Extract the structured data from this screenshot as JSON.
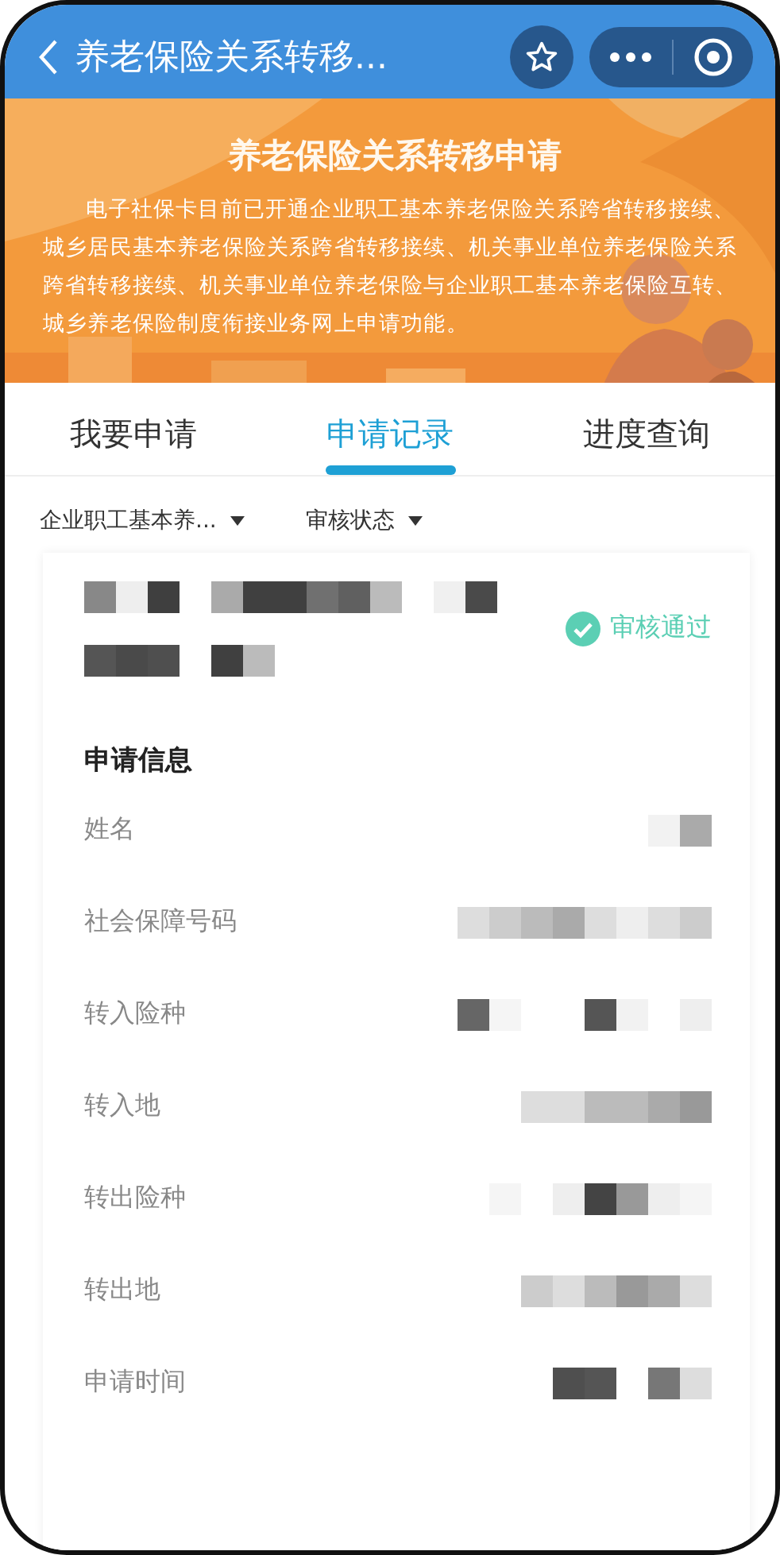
{
  "header": {
    "title": "养老保险关系转移..."
  },
  "banner": {
    "kind": "picture",
    "title": "养老保险关系转移申请",
    "text": "电子社保卡目前已开通企业职工基本养老保险关系跨省转移接续、城乡居民基本养老保险关系跨省转移接续、机关事业单位养老保险关系跨省转移接续、机关事业单位养老保险与企业职工基本养老保险互转、城乡养老保险制度衔接业务网上申请功能。"
  },
  "tabs": [
    {
      "label": "我要申请",
      "selected": false
    },
    {
      "label": "申请记录",
      "selected": true
    },
    {
      "label": "进度查询",
      "selected": false
    }
  ],
  "filters": [
    {
      "label": "企业职工基本养..."
    },
    {
      "label": "审核状态"
    }
  ],
  "record": {
    "status": "审核通过",
    "section_title": "申请信息",
    "fields": [
      {
        "label": "姓名"
      },
      {
        "label": "社会保障号码"
      },
      {
        "label": "转入险种"
      },
      {
        "label": "转入地"
      },
      {
        "label": "转出险种"
      },
      {
        "label": "转出地"
      },
      {
        "label": "申请时间"
      }
    ]
  }
}
